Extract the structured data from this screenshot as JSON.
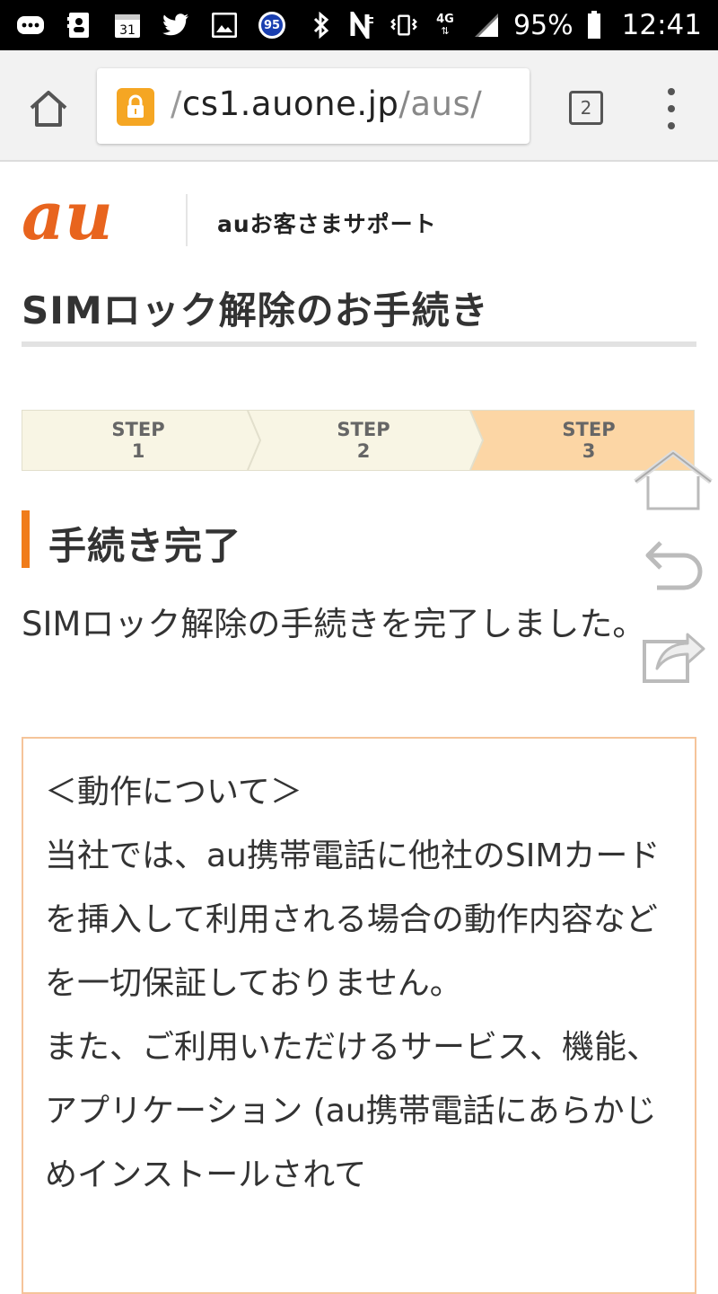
{
  "status_bar": {
    "battery_percent": "95%",
    "time": "12:41",
    "calendar_day": "31",
    "notification_badge": "95",
    "network_type": "4G",
    "icons": [
      "messages-icon",
      "contacts-icon",
      "calendar-icon",
      "twitter-icon",
      "gallery-icon",
      "badge-icon",
      "bluetooth-icon",
      "nfc-icon",
      "vibrate-icon",
      "signal-icon",
      "battery-icon"
    ]
  },
  "browser": {
    "url_prefix": "/",
    "url_domain": "cs1.auone.jp",
    "url_path": "/aus/",
    "tab_count": "2"
  },
  "header": {
    "support_title": "auお客さまサポート",
    "logo_text": "au",
    "brand_color": "#e8641e"
  },
  "page": {
    "title": "SIMロック解除のお手続き"
  },
  "steps": [
    {
      "label": "STEP",
      "number": "1",
      "active": false
    },
    {
      "label": "STEP",
      "number": "2",
      "active": false
    },
    {
      "label": "STEP",
      "number": "3",
      "active": true
    }
  ],
  "section": {
    "heading": "手続き完了",
    "message": "SIMロック解除の手続きを完了しました。"
  },
  "notice": {
    "text": "＜動作について＞\n当社では、au携帯電話に他社のSIMカードを挿入して利用される場合の動作内容などを一切保証しておりません。\nまた、ご利用いただけるサービス、機能、アプリケーション (au携帯電話にあらかじめインストールされて"
  },
  "colors": {
    "step_inactive": "#f8f5e4",
    "step_active": "#fcd6a5",
    "section_accent": "#f07c1b",
    "notice_border": "#f5c49a"
  }
}
